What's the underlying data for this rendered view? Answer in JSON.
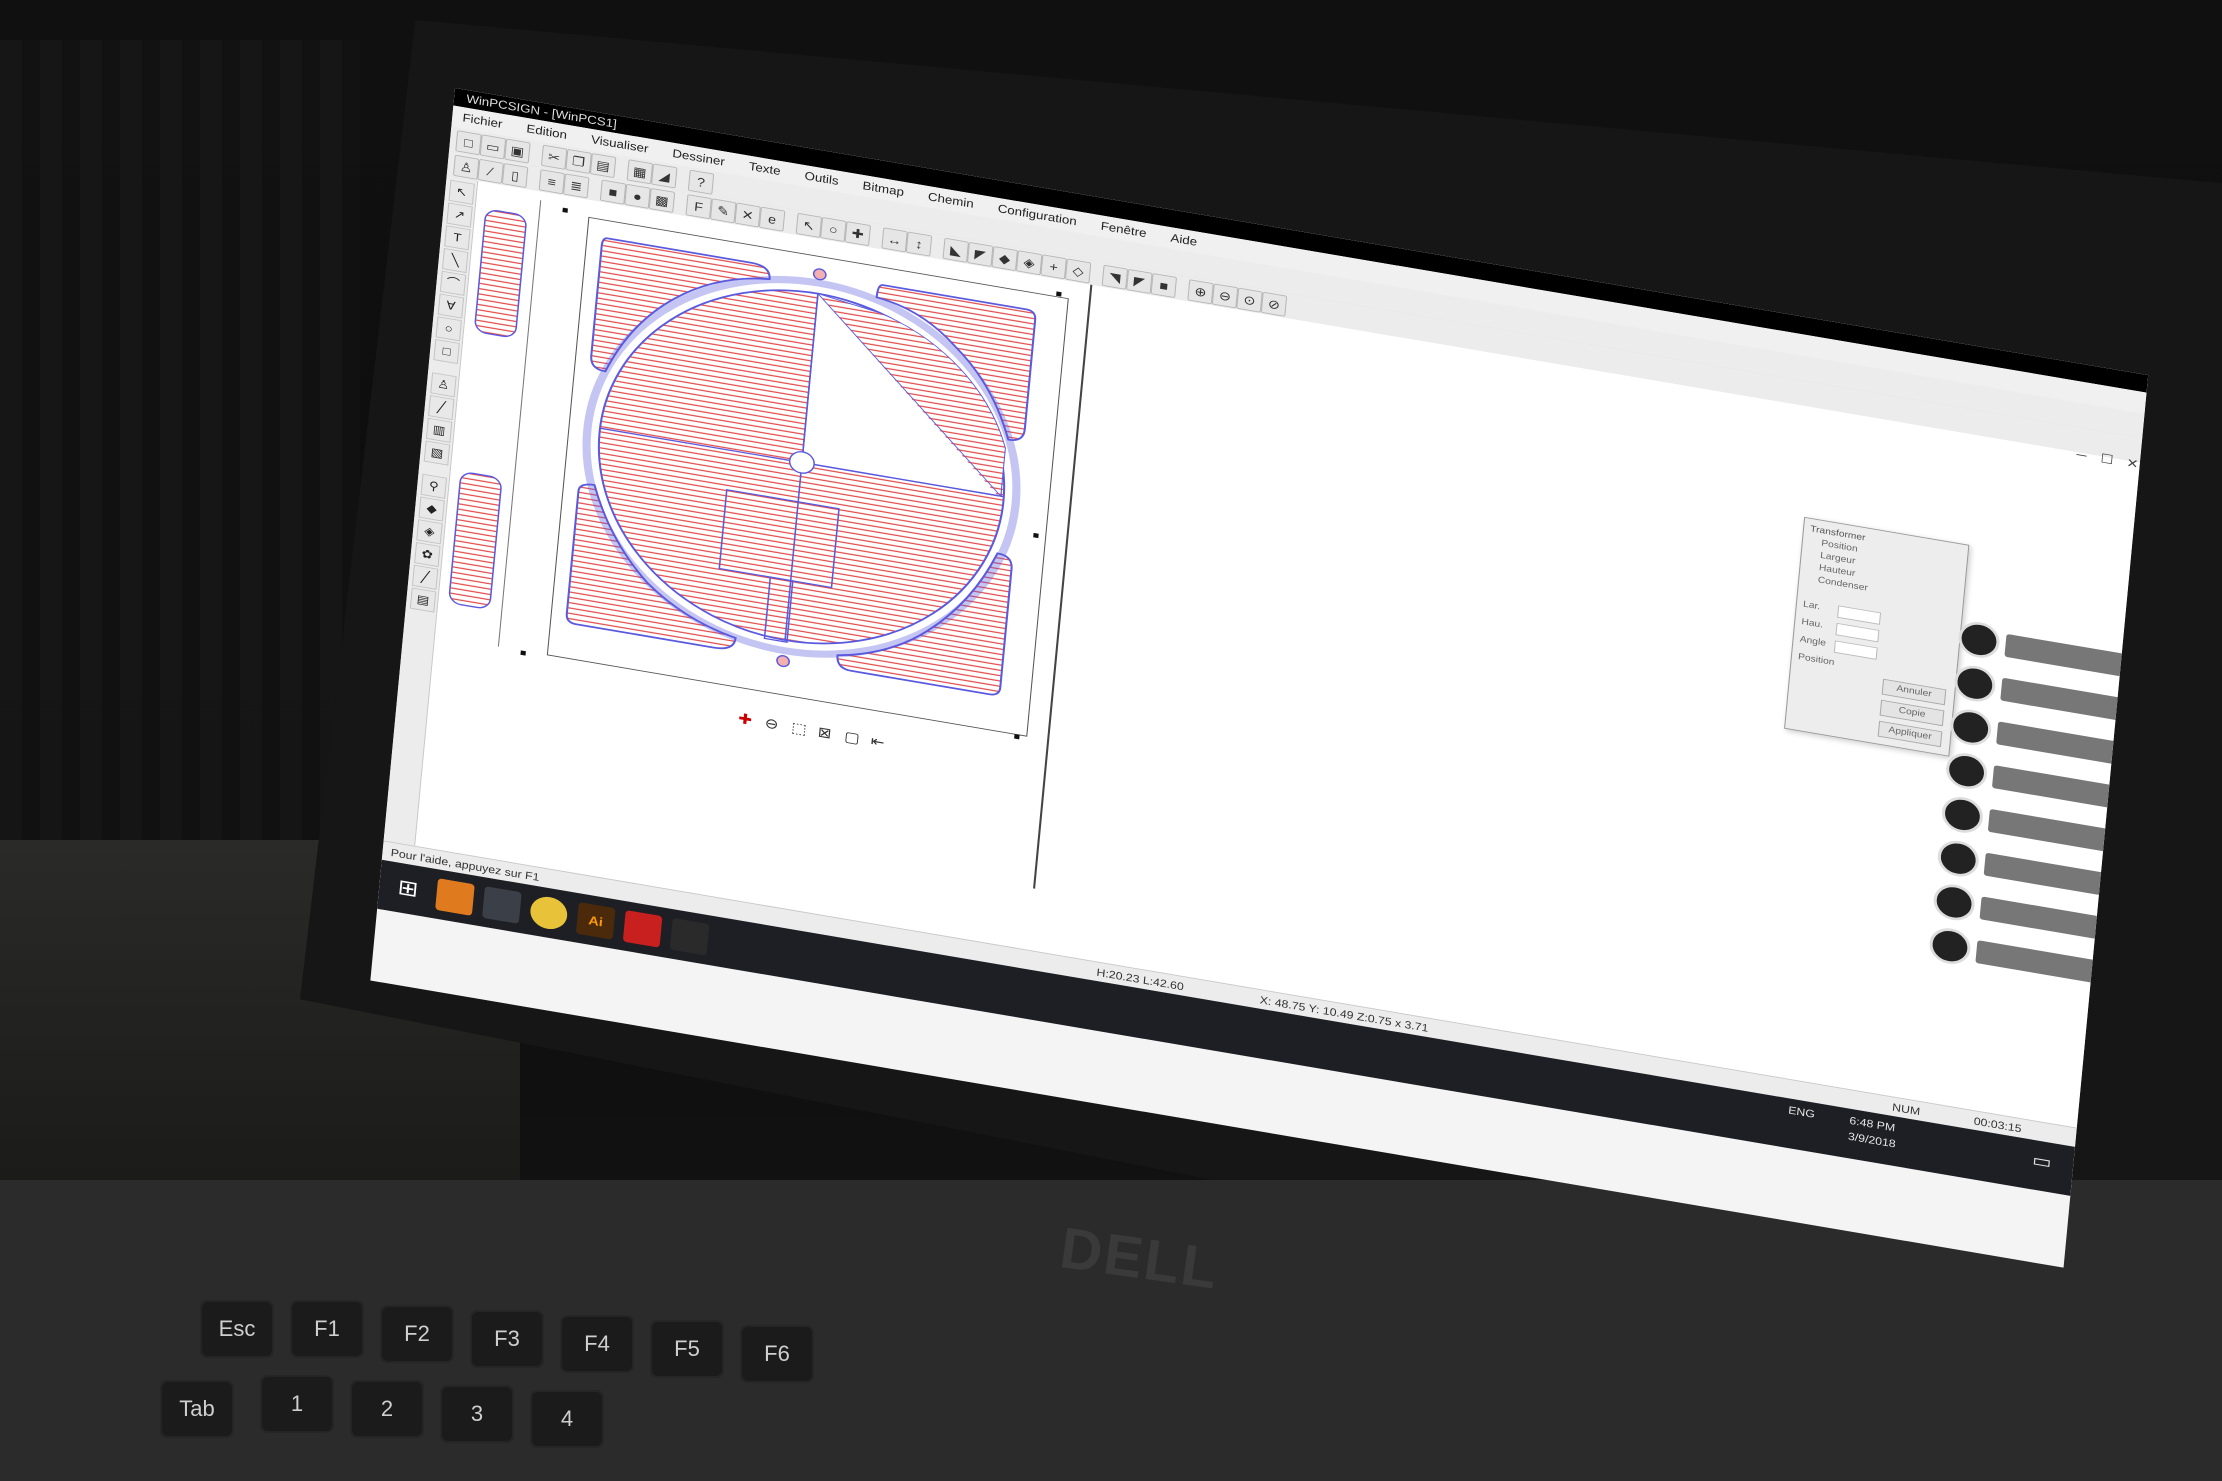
{
  "window": {
    "title": "WinPCSIGN - [WinPCS1]"
  },
  "menu": [
    "Fichier",
    "Edition",
    "Visualiser",
    "Dessiner",
    "Texte",
    "Outils",
    "Bitmap",
    "Chemin",
    "Configuration",
    "Fenêtre",
    "Aide"
  ],
  "properties_panel": {
    "tree": [
      "Transformer",
      "Position",
      "Largeur",
      "Hauteur",
      "Condenser"
    ],
    "fields": [
      "Lar.",
      "Hau.",
      "Angle"
    ],
    "position_label": "Position",
    "buttons": [
      "Annuler",
      "Copie",
      "Appliquer"
    ]
  },
  "status": {
    "help": "Pour l'aide, appuyez sur F1",
    "size": "H:20.23  L:42.60",
    "coords": "X: 48.75  Y: 10.49  Z:0.75  x 3.71",
    "num": "NUM",
    "time_small": "00:03:15"
  },
  "taskbar": {
    "lang": "ENG",
    "time": "6:48 PM",
    "date": "3/9/2018"
  },
  "hardware": {
    "brand": "DELL",
    "keys": [
      "Esc",
      "F1",
      "F2",
      "F3",
      "F4",
      "F5",
      "F6",
      "Tab",
      "1",
      "2",
      "3",
      "4"
    ]
  },
  "colors": {
    "hatch": "#e24a4a",
    "outline": "#5a5ae0",
    "taskbar": "#1d1f24"
  }
}
